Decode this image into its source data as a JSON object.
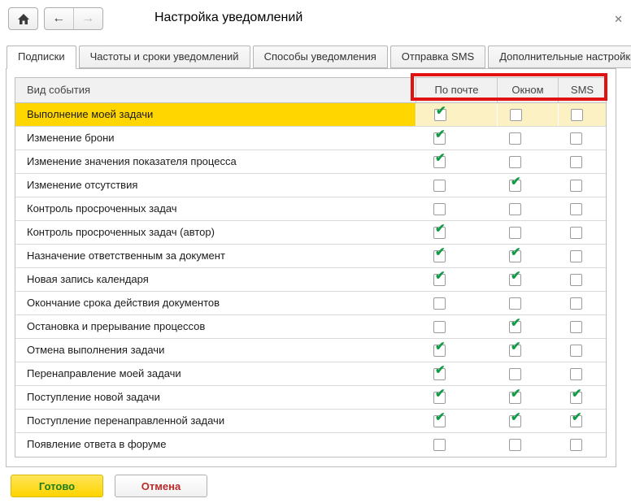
{
  "window": {
    "title": "Настройка уведомлений",
    "close_icon": "✕"
  },
  "toolbar": {
    "home_icon": "home",
    "back_icon": "←",
    "forward_icon": "→"
  },
  "tabs": [
    {
      "label": "Подписки",
      "active": true
    },
    {
      "label": "Частоты и сроки уведомлений",
      "active": false
    },
    {
      "label": "Способы уведомления",
      "active": false
    },
    {
      "label": "Отправка SMS",
      "active": false
    },
    {
      "label": "Дополнительные настройки",
      "active": false
    }
  ],
  "table": {
    "columns": [
      "Вид события",
      "По почте",
      "Окном",
      "SMS"
    ],
    "rows": [
      {
        "label": "Выполнение моей задачи",
        "mail": true,
        "window": false,
        "sms": false,
        "selected": true
      },
      {
        "label": "Изменение брони",
        "mail": true,
        "window": false,
        "sms": false,
        "selected": false
      },
      {
        "label": "Изменение значения показателя процесса",
        "mail": true,
        "window": false,
        "sms": false,
        "selected": false
      },
      {
        "label": "Изменение отсутствия",
        "mail": false,
        "window": true,
        "sms": false,
        "selected": false
      },
      {
        "label": "Контроль просроченных задач",
        "mail": false,
        "window": false,
        "sms": false,
        "selected": false
      },
      {
        "label": "Контроль просроченных задач (автор)",
        "mail": true,
        "window": false,
        "sms": false,
        "selected": false
      },
      {
        "label": "Назначение ответственным за документ",
        "mail": true,
        "window": true,
        "sms": false,
        "selected": false
      },
      {
        "label": "Новая запись календаря",
        "mail": true,
        "window": true,
        "sms": false,
        "selected": false
      },
      {
        "label": "Окончание срока действия документов",
        "mail": false,
        "window": false,
        "sms": false,
        "selected": false
      },
      {
        "label": "Остановка и прерывание процессов",
        "mail": false,
        "window": true,
        "sms": false,
        "selected": false
      },
      {
        "label": "Отмена выполнения задачи",
        "mail": true,
        "window": true,
        "sms": false,
        "selected": false
      },
      {
        "label": "Перенаправление моей задачи",
        "mail": true,
        "window": false,
        "sms": false,
        "selected": false
      },
      {
        "label": "Поступление новой задачи",
        "mail": true,
        "window": true,
        "sms": true,
        "selected": false
      },
      {
        "label": "Поступление перенаправленной задачи",
        "mail": true,
        "window": true,
        "sms": true,
        "selected": false
      },
      {
        "label": "Появление ответа в форуме",
        "mail": false,
        "window": false,
        "sms": false,
        "selected": false
      }
    ]
  },
  "buttons": {
    "done": "Готово",
    "cancel": "Отмена"
  },
  "check_mark": "✔",
  "colors": {
    "selected_row": "#FFD600",
    "selected_cells": "#FBF1C3",
    "check_green": "#129B47",
    "annotation_red": "#E01212",
    "header_bg": "#F1F1F1",
    "done_text_green": "#1B7D1B",
    "cancel_text_red": "#BB2A2A"
  }
}
